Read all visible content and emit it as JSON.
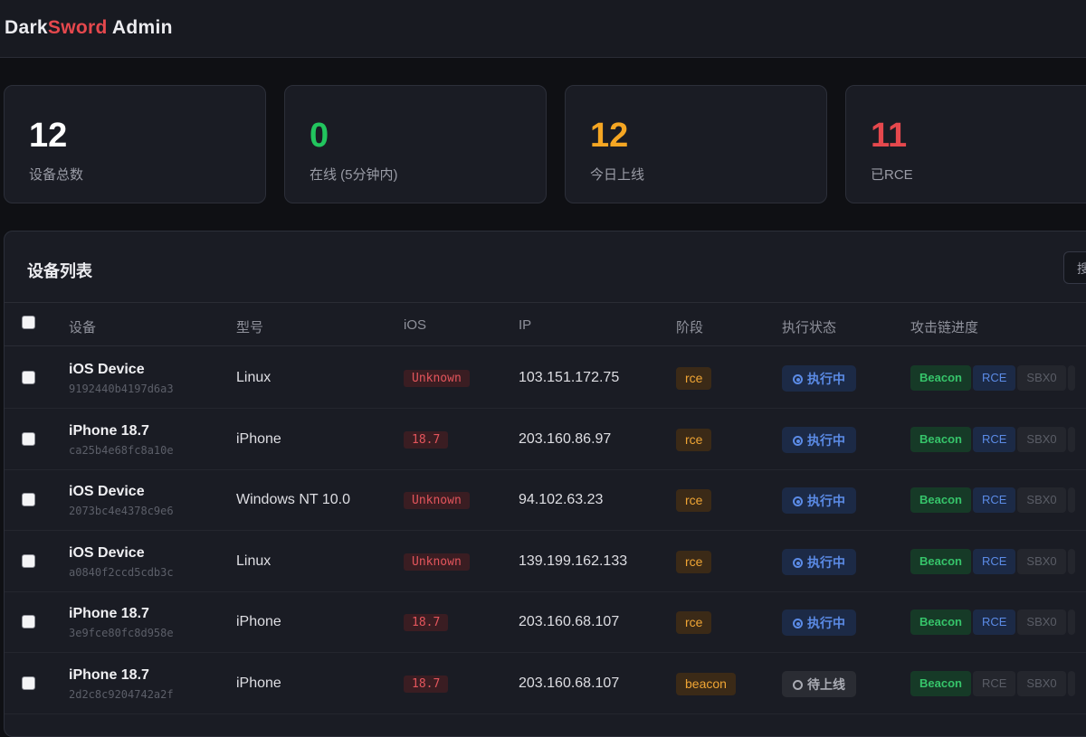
{
  "brand": {
    "part1": "Dark",
    "part2": "Sword",
    "part3": " Admin"
  },
  "colors": {
    "accent_red": "#e5484d",
    "green": "#22c55e",
    "orange": "#f5a623",
    "red": "#e5484d"
  },
  "stats": [
    {
      "value": "12",
      "label": "设备总数",
      "color": "#ffffff"
    },
    {
      "value": "0",
      "label": "在线 (5分钟内)",
      "color": "#22c55e"
    },
    {
      "value": "12",
      "label": "今日上线",
      "color": "#f5a623"
    },
    {
      "value": "11",
      "label": "已RCE",
      "color": "#e5484d"
    }
  ],
  "panel": {
    "title": "设备列表",
    "search_label": "搜"
  },
  "table": {
    "headers": {
      "device": "设备",
      "model": "型号",
      "ios": "iOS",
      "ip": "IP",
      "stage": "阶段",
      "exec": "执行状态",
      "chain": "攻击链进度"
    },
    "rows": [
      {
        "name": "iOS Device",
        "id": "9192440b4197d6a3",
        "model": "Linux",
        "ios": "Unknown",
        "ip": "103.151.172.75",
        "stage": "rce",
        "exec": "执行中",
        "exec_state": "running",
        "chain": {
          "beacon": "Beacon",
          "rce": "RCE",
          "sbx0": "SBX0"
        }
      },
      {
        "name": "iPhone 18.7",
        "id": "ca25b4e68fc8a10e",
        "model": "iPhone",
        "ios": "18.7",
        "ip": "203.160.86.97",
        "stage": "rce",
        "exec": "执行中",
        "exec_state": "running",
        "chain": {
          "beacon": "Beacon",
          "rce": "RCE",
          "sbx0": "SBX0"
        }
      },
      {
        "name": "iOS Device",
        "id": "2073bc4e4378c9e6",
        "model": "Windows NT 10.0",
        "ios": "Unknown",
        "ip": "94.102.63.23",
        "stage": "rce",
        "exec": "执行中",
        "exec_state": "running",
        "chain": {
          "beacon": "Beacon",
          "rce": "RCE",
          "sbx0": "SBX0"
        }
      },
      {
        "name": "iOS Device",
        "id": "a0840f2ccd5cdb3c",
        "model": "Linux",
        "ios": "Unknown",
        "ip": "139.199.162.133",
        "stage": "rce",
        "exec": "执行中",
        "exec_state": "running",
        "chain": {
          "beacon": "Beacon",
          "rce": "RCE",
          "sbx0": "SBX0"
        }
      },
      {
        "name": "iPhone 18.7",
        "id": "3e9fce80fc8d958e",
        "model": "iPhone",
        "ios": "18.7",
        "ip": "203.160.68.107",
        "stage": "rce",
        "exec": "执行中",
        "exec_state": "running",
        "chain": {
          "beacon": "Beacon",
          "rce": "RCE",
          "sbx0": "SBX0"
        }
      },
      {
        "name": "iPhone 18.7",
        "id": "2d2c8c9204742a2f",
        "model": "iPhone",
        "ios": "18.7",
        "ip": "203.160.68.107",
        "stage": "beacon",
        "exec": "待上线",
        "exec_state": "pending",
        "chain": {
          "beacon": "Beacon",
          "rce": "RCE",
          "sbx0": "SBX0"
        }
      }
    ]
  }
}
